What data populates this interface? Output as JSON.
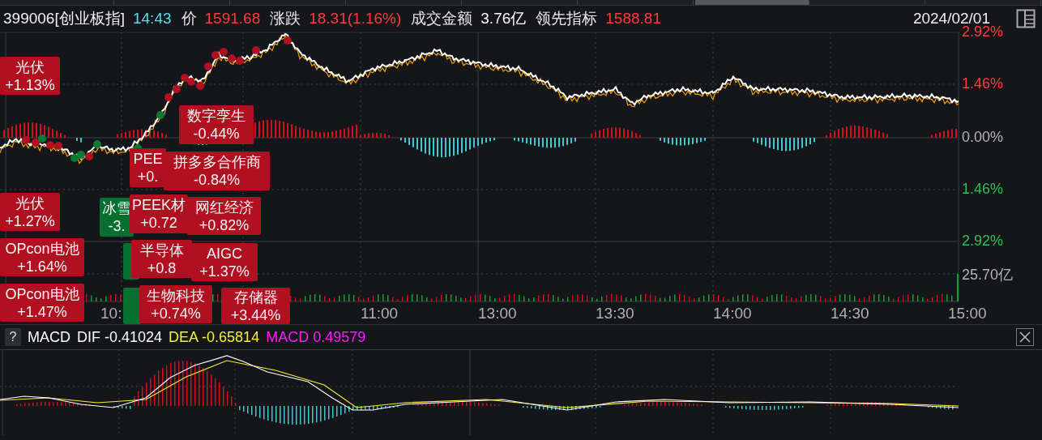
{
  "header": {
    "code": "399006[创业板指]",
    "time": "14:43",
    "date": "2024/02/01",
    "fields": [
      {
        "label": "价",
        "value": "1591.68",
        "color": "#ff3b3b"
      },
      {
        "label": "涨跌",
        "value": "18.31(1.16%)",
        "color": "#ff3b3b"
      },
      {
        "label": "成交金额",
        "value": "3.76亿",
        "color": "#ffffff"
      },
      {
        "label": "领先指标",
        "value": "1588.81",
        "color": "#ff3b3b"
      }
    ]
  },
  "axis": [
    {
      "text": "2.92%",
      "color": "#ff3b3b"
    },
    {
      "text": "1.46%",
      "color": "#ff3b3b"
    },
    {
      "text": "0.00%",
      "color": "#b4b4b4"
    },
    {
      "text": "1.46%",
      "color": "#2fbf5a"
    },
    {
      "text": "2.92%",
      "color": "#2fbf5a"
    },
    {
      "text": "25.70亿",
      "color": "#b4b4b4"
    }
  ],
  "times": [
    "10:",
    "11:00",
    "13:00",
    "13:30",
    "14:00",
    "14:30",
    "15:00"
  ],
  "labels": [
    {
      "name": "光伏",
      "change": "+1.13%",
      "color": "#b0101f"
    },
    {
      "name": "数字孪生",
      "change": "-0.44%",
      "color": "#b0101f"
    },
    {
      "name": "PEE",
      "change": "+0.",
      "color": "#b0101f"
    },
    {
      "name": "拼多多合作商",
      "change": "-0.84%",
      "color": "#b0101f"
    },
    {
      "name": "光伏",
      "change": "+1.27%",
      "color": "#b0101f"
    },
    {
      "name": "冰雪",
      "change": "-3.",
      "color": "#077031"
    },
    {
      "name": "PEEK材",
      "change": "+0.72",
      "color": "#b0101f"
    },
    {
      "name": "网红经济",
      "change": "+0.82%",
      "color": "#b0101f"
    },
    {
      "name": "OPcon电池",
      "change": "+1.64%",
      "color": "#b0101f"
    },
    {
      "color": "#077031"
    },
    {
      "name": "半导体",
      "change": "+0.8",
      "color": "#b0101f"
    },
    {
      "name": "AIGC",
      "change": "+1.37%",
      "color": "#b0101f"
    },
    {
      "name": "OPcon电池",
      "change": "+1.47%",
      "color": "#b0101f"
    },
    {
      "color": "#077031"
    },
    {
      "name": "生物科技",
      "change": "+0.74%",
      "color": "#b0101f"
    },
    {
      "name": "存储器",
      "change": "+3.44%",
      "color": "#b0101f"
    }
  ],
  "macd": {
    "help": "?",
    "title": "MACD",
    "items": [
      {
        "label": "DIF",
        "value": "-0.41024",
        "color": "#ffffff"
      },
      {
        "label": "DEA",
        "value": "-0.65814",
        "color": "#f5f032"
      },
      {
        "label": "MACD",
        "value": "0.49579",
        "color": "#ff1aff"
      }
    ]
  }
}
